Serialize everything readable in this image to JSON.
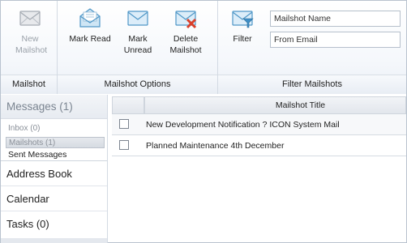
{
  "ribbon": {
    "groups": {
      "mailshot": "Mailshot",
      "mailshot_options": "Mailshot Options",
      "filter_mailshots": "Filter Mailshots"
    },
    "buttons": {
      "new_line1": "New",
      "new_line2": "Mailshot",
      "mark_read": "Mark Read",
      "mark_unread_line1": "Mark",
      "mark_unread_line2": "Unread",
      "delete_line1": "Delete",
      "delete_line2": "Mailshot",
      "filter": "Filter"
    },
    "fields": {
      "mailshot_name": "Mailshot Name",
      "from_email": "From Email"
    },
    "icons": {
      "new": "envelope-icon",
      "mark_read": "open-envelope-icon",
      "mark_unread": "envelope-icon",
      "delete": "envelope-delete-icon",
      "filter": "envelope-filter-icon"
    }
  },
  "nav": {
    "header": "Messages (1)",
    "inbox": "Inbox (0)",
    "mailshots": "Mailshots (1)",
    "sent": "Sent Messages",
    "sections": [
      "Address Book",
      "Calendar",
      "Tasks (0)"
    ]
  },
  "grid": {
    "column_title": "Mailshot Title",
    "rows": [
      "New Development Notification ? ICON System Mail",
      "Planned Maintenance 4th December"
    ]
  },
  "colors": {
    "envelope_blue": "#5aa6d6",
    "delete_red": "#d9402b",
    "nav_text_muted": "#7b8591"
  }
}
